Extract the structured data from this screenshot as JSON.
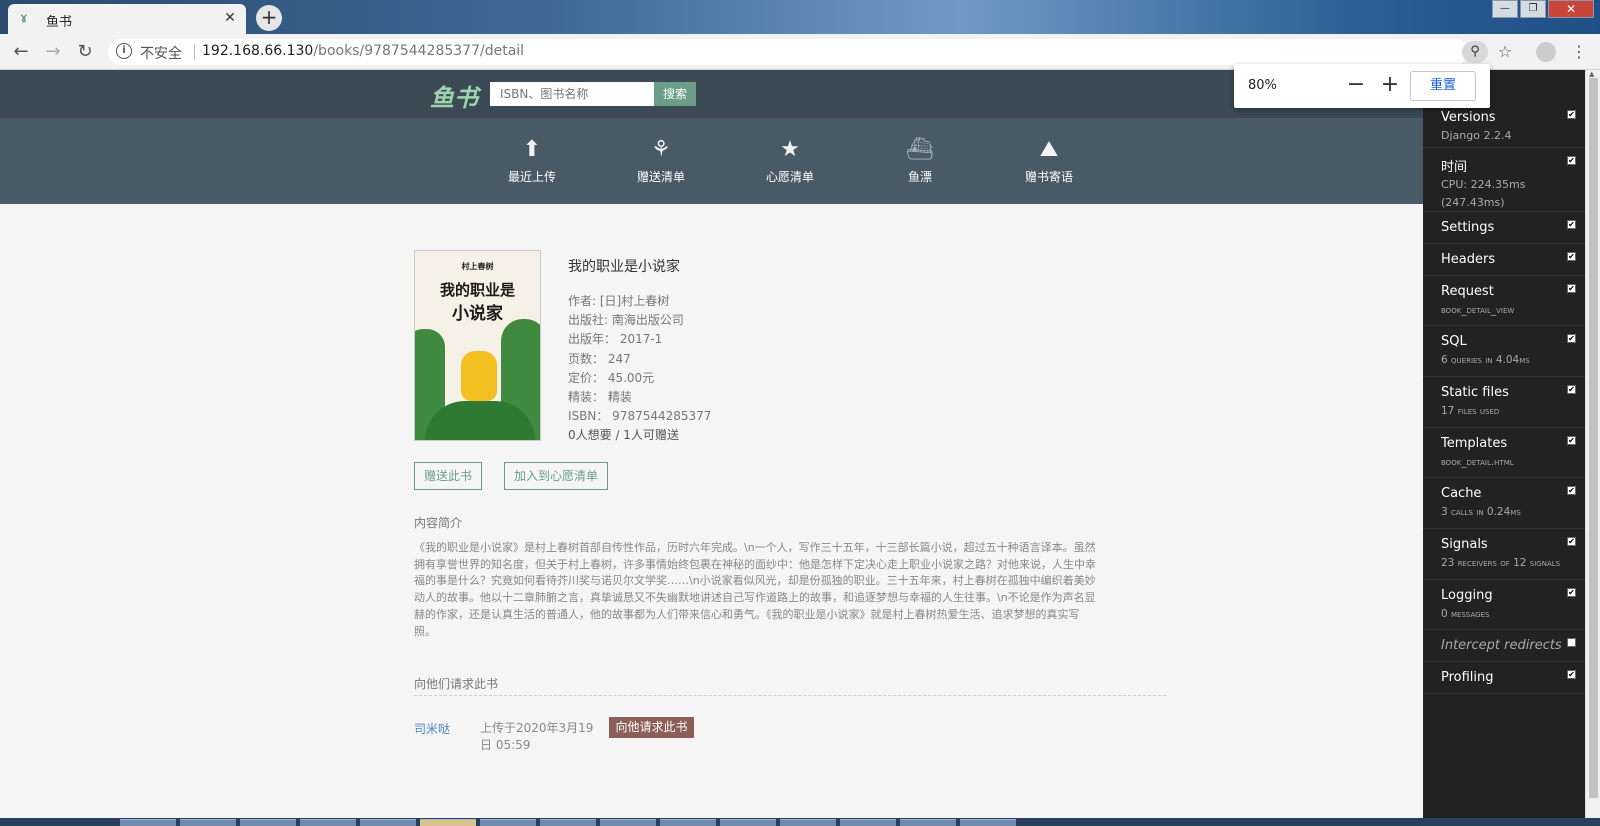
{
  "browser": {
    "tab_title": "鱼书",
    "tab_favicon": "fish-book-favicon",
    "new_tab_label": "+",
    "close_tab_label": "✕",
    "security_label": "不安全",
    "url_host": "192.168.66.130",
    "url_path": "/books/9787544285377/detail",
    "zoom": {
      "percent": "80%",
      "minus": "−",
      "plus": "+",
      "reset": "重置"
    },
    "window_controls": [
      "minimize",
      "maximize",
      "close"
    ]
  },
  "site": {
    "logo": "鱼书",
    "search_placeholder": "ISBN、图书名称",
    "search_button": "搜索",
    "menu": [
      {
        "label": "最近上传",
        "icon": "arrow-up-icon"
      },
      {
        "label": "赠送清单",
        "icon": "flower-icon"
      },
      {
        "label": "心愿清单",
        "icon": "star-icon"
      },
      {
        "label": "鱼漂",
        "icon": "ship-icon"
      },
      {
        "label": "赠书寄语",
        "icon": "mountain-icon"
      }
    ]
  },
  "book": {
    "cover": {
      "author": "村上春树",
      "title_line1": "我的职业是",
      "title_line2": "小说家"
    },
    "title": "我的职业是小说家",
    "author": "作者: [日]村上春树",
    "publisher": "出版社: 南海出版公司",
    "pubdate": "出版年： 2017-1",
    "pages": "页数： 247",
    "price": "定价： 45.00元",
    "binding": "精装： 精装",
    "isbn": "ISBN： 9787544285377",
    "counts": "0人想要 / 1人可赠送",
    "gift_button": "赠送此书",
    "wish_button": "加入到心愿清单",
    "summary_title": "内容简介",
    "summary": "《我的职业是小说家》是村上春树首部自传性作品，历时六年完成。\\n一个人，写作三十五年，十三部长篇小说，超过五十种语言译本。虽然拥有享誉世界的知名度，但关于村上春树，许多事情始终包裹在神秘的面纱中：他是怎样下定决心走上职业小说家之路？对他来说，人生中幸福的事是什么？究竟如何看待芥川奖与诺贝尔文学奖……\\n小说家看似风光，却是份孤独的职业。三十五年来，村上春树在孤独中编织着美妙动人的故事。他以十二章肺腑之言，真挚诚恳又不失幽默地讲述自己写作道路上的故事，和追逐梦想与幸福的人生往事。\\n不论是作为声名显赫的作家，还是认真生活的普通人，他的故事都为人们带来信心和勇气。《我的职业是小说家》就是村上春树热爱生活、追求梦想的真实写照。",
    "request_title": "向他们请求此书",
    "gifts": [
      {
        "user": "司米哒",
        "uploaded": "上传于2020年3月19日 05:59",
        "request_button": "向他请求此书"
      }
    ]
  },
  "djdt": {
    "panels": [
      {
        "name": "Versions",
        "sub": "Django 2.2.4",
        "checked": true
      },
      {
        "name": "时间",
        "sub": "CPU: 224.35ms (247.43ms)",
        "checked": true
      },
      {
        "name": "Settings",
        "sub": "",
        "checked": true
      },
      {
        "name": "Headers",
        "sub": "",
        "checked": true
      },
      {
        "name": "Request",
        "sub": "book_detail_view",
        "checked": true
      },
      {
        "name": "SQL",
        "sub": "6 queries in 4.04ms",
        "checked": true
      },
      {
        "name": "Static files",
        "sub": "17 files used",
        "checked": true
      },
      {
        "name": "Templates",
        "sub": "book_detail.html",
        "checked": true
      },
      {
        "name": "Cache",
        "sub": "3 calls in 0.24ms",
        "checked": true
      },
      {
        "name": "Signals",
        "sub": "23 receivers of 12 signals",
        "checked": true
      },
      {
        "name": "Logging",
        "sub": "0 messages",
        "checked": true
      },
      {
        "name": "Intercept redirects",
        "sub": "",
        "checked": false
      },
      {
        "name": "Profiling",
        "sub": "",
        "checked": true
      }
    ]
  }
}
